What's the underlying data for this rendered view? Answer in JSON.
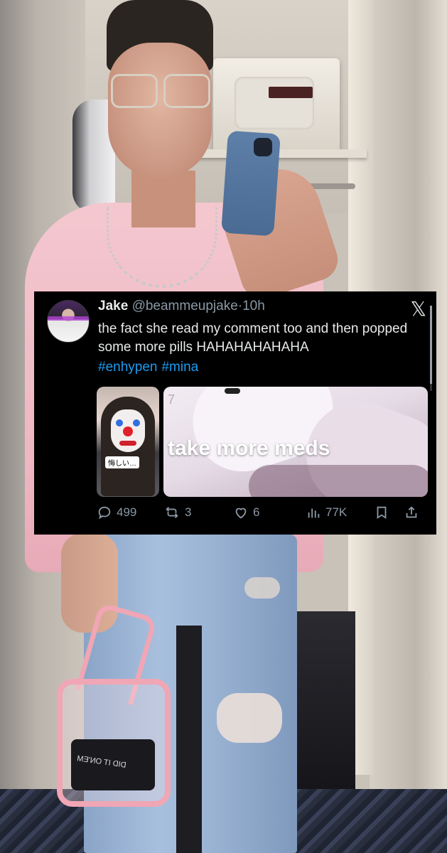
{
  "photo": {
    "bag_text": "DID IT ON'EM"
  },
  "tweet": {
    "display_name": "Jake",
    "handle": "@beammeupjake",
    "separator": "·",
    "time": "10h",
    "platform_logo": "𝕏",
    "text": "the fact she read my comment too and then popped some more pills HAHAHAHAHAHA",
    "hashtags": [
      "#enhypen",
      "#mina"
    ],
    "media": [
      {
        "type": "image",
        "description_icon": "clown-photo",
        "overlay_text": "悔しい…"
      },
      {
        "type": "image",
        "corner_text": "7",
        "caption": "take more meds"
      }
    ],
    "actions": {
      "replies": "499",
      "reposts": "3",
      "likes": "6",
      "views": "77K"
    }
  },
  "colors": {
    "tweet_bg": "#000000",
    "text": "#e7e9ea",
    "muted": "#8b98a5",
    "link": "#1d9bf0"
  }
}
